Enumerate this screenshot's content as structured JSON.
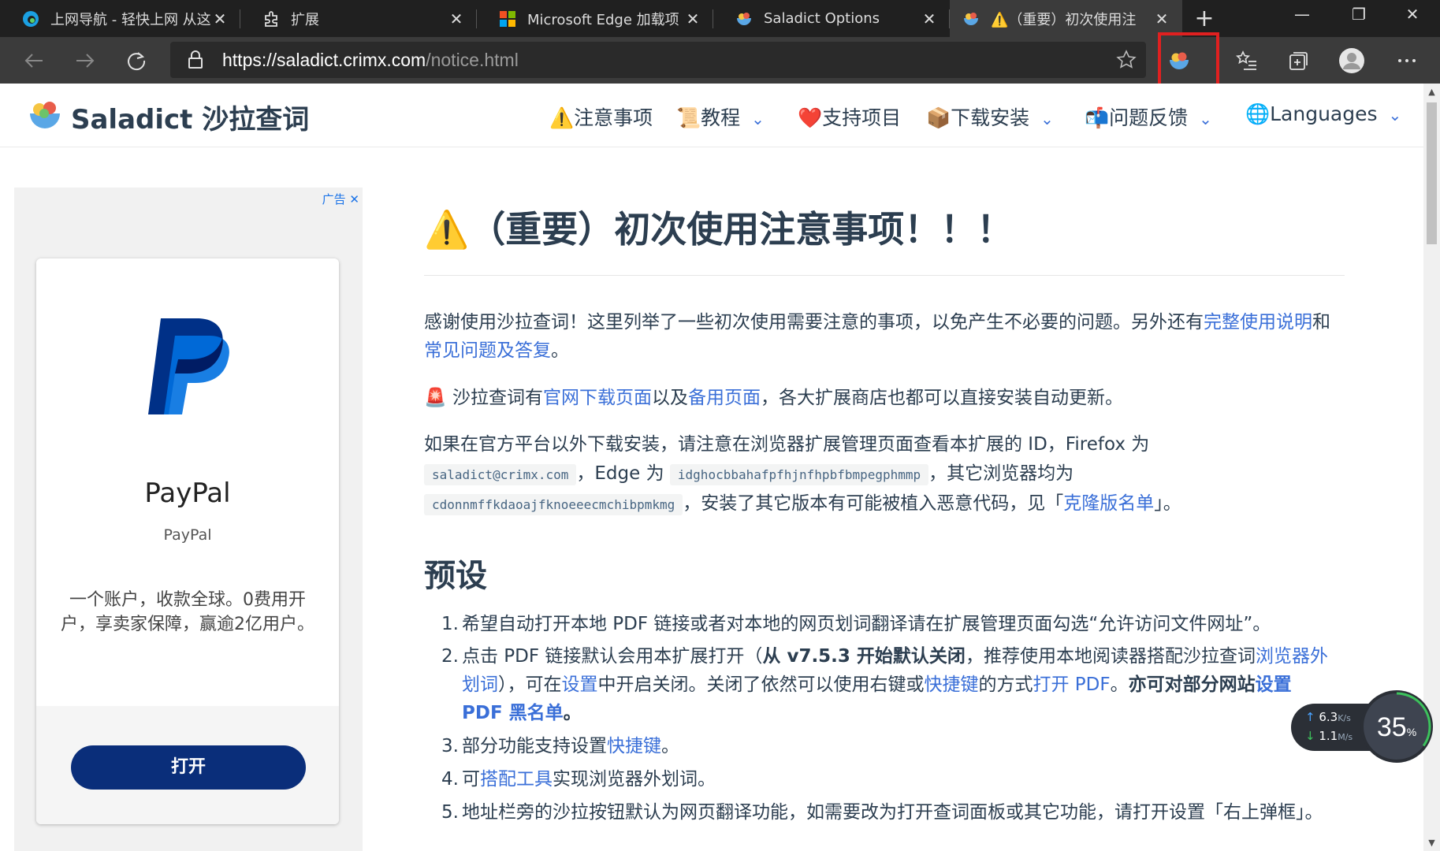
{
  "browser": {
    "tabs": [
      {
        "title": "上网导航 - 轻快上网 从这",
        "close": "✕"
      },
      {
        "title": "扩展",
        "close": "✕"
      },
      {
        "title": "Microsoft Edge 加载项 - ",
        "close": "✕"
      },
      {
        "title": "Saladict Options",
        "close": "✕"
      },
      {
        "title": "⚠️（重要）初次使用注",
        "close": "✕"
      }
    ],
    "new_tab": "+",
    "window_controls": [
      "—",
      "❐",
      "✕"
    ],
    "url_scheme": "https://",
    "url_host": "saladict.crimx.com",
    "url_path": "/notice.html"
  },
  "site": {
    "title": "Saladict 沙拉查词",
    "nav": [
      {
        "label": "⚠️注意事项"
      },
      {
        "label": "📜教程"
      },
      {
        "label": "❤️支持项目"
      },
      {
        "label": "📦下载安装"
      },
      {
        "label": "📬问题反馈"
      },
      {
        "label": "🌐Languages"
      }
    ]
  },
  "ad": {
    "badge": "广告",
    "name": "PayPal",
    "subtitle": "PayPal",
    "description": "一个账户，收款全球。0费用开户，享卖家保障，赢逾2亿用户。",
    "button": "打开"
  },
  "article": {
    "title": "⚠️（重要）初次使用注意事项！！！",
    "p1_text": "感谢使用沙拉查词！这里列举了一些初次使用需要注意的事项，以免产生不必要的问题。另外还有",
    "p1_link1": "完整使用说明",
    "p1_and": "和",
    "p1_link2": "常见问题及答复",
    "p1_end": "。",
    "p2_icon": "🚨",
    "p2_a": " 沙拉查词有",
    "p2_link1": "官网下载页面",
    "p2_b": "以及",
    "p2_link2": "备用页面",
    "p2_c": "，各大扩展商店也都可以直接安装自动更新。",
    "p3_a": "如果在官方平台以外下载安装，请注意在浏览器扩展管理页面查看本扩展的 ID，Firefox 为",
    "p3_code1": "saladict@crimx.com",
    "p3_b": "，Edge 为",
    "p3_code2": "idghocbbahafpfhjnfhpbfbmpegphmmp",
    "p3_c": "，其它浏览器均为",
    "p3_code3": "cdonnmffkdaoajfknoeeecmchibpmkmg",
    "p3_d": "，安装了其它版本有可能被植入恶意代码，见「",
    "p3_link": "克隆版名单",
    "p3_e": "」。",
    "section": "预设",
    "li1": "希望自动打开本地 PDF 链接或者对本地的网页划词翻译请在扩展管理页面勾选“允许访问文件网址”。",
    "li2_a": "点击 PDF 链接默认会用本扩展打开（",
    "li2_b": "从 v7.5.3 开始默认关闭",
    "li2_c": "，推荐使用本地阅读器搭配沙拉查词",
    "li2_link1": "浏览器外划词",
    "li2_d": "），可在",
    "li2_link2": "设置",
    "li2_e": "中开启关闭。关闭了依然可以使用右键或",
    "li2_link3": "快捷键",
    "li2_f": "的方式",
    "li2_link4": "打开 PDF",
    "li2_g": "。",
    "li2_h": "亦可对部分网站",
    "li2_link5": "设置 PDF 黑名单",
    "li2_i": "。",
    "li3_a": "部分功能支持设置",
    "li3_link": "快捷键",
    "li3_b": "。",
    "li4_a": "可",
    "li4_link": "搭配工具",
    "li4_b": "实现浏览器外划词。",
    "li5": "地址栏旁的沙拉按钮默认为网页翻译功能，如需要改为打开查词面板或其它功能，请打开设置「右上弹框」。",
    "nums": [
      "1.",
      "2.",
      "3.",
      "4.",
      "5."
    ]
  },
  "widget": {
    "up": "6.3",
    "up_unit": "K/s",
    "down": "1.1",
    "down_unit": "M/s",
    "percent": "35",
    "percent_sign": "%"
  }
}
